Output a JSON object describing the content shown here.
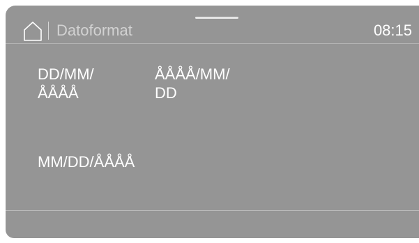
{
  "header": {
    "title": "Datoformat",
    "time": "08:15"
  },
  "options": [
    {
      "line1": "DD/MM/",
      "line2": "ÅÅÅÅ"
    },
    {
      "line1": "ÅÅÅÅ/MM/",
      "line2": "DD"
    },
    {
      "line1": "MM/DD/ÅÅÅÅ",
      "line2": ""
    }
  ],
  "icons": {
    "home": "home-icon"
  },
  "colors": {
    "screen_background": "#959595",
    "text": "#ffffff",
    "title_text": "#d2d2d2"
  }
}
